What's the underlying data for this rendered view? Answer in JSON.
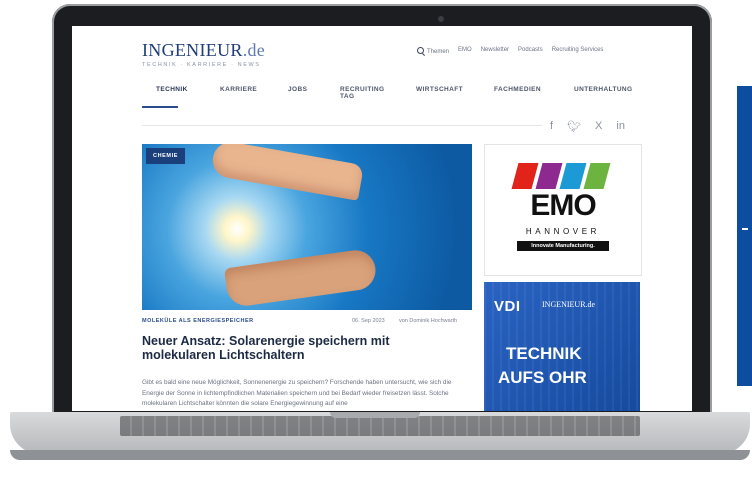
{
  "site": {
    "logo_main": "INGENIEUR",
    "logo_tld": ".de",
    "logo_sub": "TECHNIK · KARRIERE · NEWS"
  },
  "topnav": [
    "Themen",
    "EMO",
    "Newsletter",
    "Podcasts",
    "Recruiting Services"
  ],
  "mainnav": [
    "TECHNIK",
    "KARRIERE",
    "JOBS",
    "RECRUITING TAG",
    "WIRTSCHAFT",
    "FACHMEDIEN",
    "UNTERHALTUNG"
  ],
  "social": [
    "f",
    "♥",
    "X",
    "in"
  ],
  "article": {
    "badge": "CHEMIE",
    "kicker": "MOLEKÜLE ALS ENERGIESPEICHER",
    "date": "06. Sep 2023",
    "author": "von Dominik Hochwarth",
    "title": "Neuer Ansatz: Solarenergie speichern mit molekularen Lichtschaltern",
    "teaser": "Gibt es bald eine neue Möglichkeit, Sonnenenergie zu speichern? Forschende haben untersucht, wie sich die Energie der Sonne in lichtempfindlichen Materialien speichern und bei Bedarf wieder freisetzen lässt. Solche molekularen Lichtschalter könnten die solare Energiegewinnung auf eine"
  },
  "ad_emo": {
    "name": "EMO",
    "city": "HANNOVER",
    "claim": "Innovate Manufacturing.",
    "bar_colors": [
      "#e2231a",
      "#8e2a8f",
      "#1b9ad6",
      "#6cb33f"
    ]
  },
  "ad_vdi": {
    "logo": "VDI",
    "partner": "INGENIEUR.de",
    "line1": "TECHNIK",
    "line2": "AUFS OHR"
  }
}
